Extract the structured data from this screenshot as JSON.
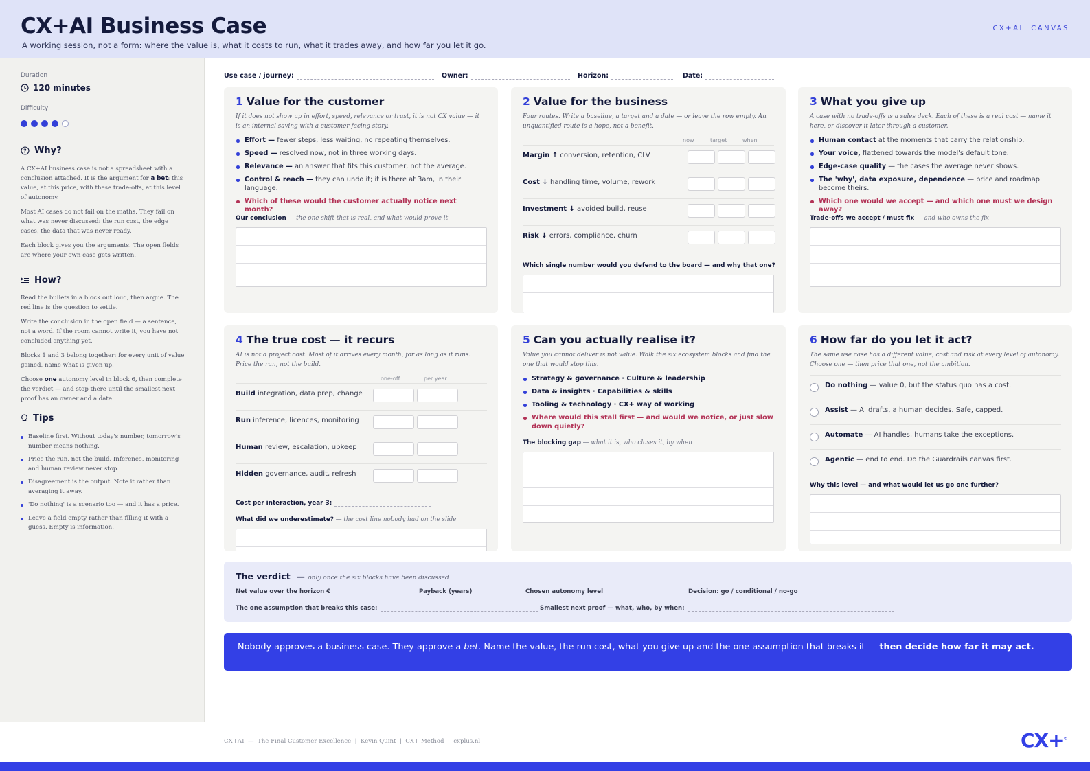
{
  "header": {
    "title": "CX+AI Business Case",
    "subtitle": "A working session, not a form: where the value is, what it costs to run, what it trades away, and how far you let it go.",
    "tag": "CX+AI  CANVAS"
  },
  "sidebar": {
    "duration_label": "Duration",
    "duration_value": "120 minutes",
    "difficulty_label": "Difficulty",
    "difficulty_level": 4,
    "difficulty_max": 5,
    "why_title": "Why?",
    "why_p1_pre": "A CX+AI business case is not a spreadsheet with a conclusion attached. It is the argument for ",
    "why_p1_bold": "a bet",
    "why_p1_post": ": this value, at this price, with these trade-offs, at this level of autonomy.",
    "why_p2": "Most AI cases do not fail on the maths. They fail on what was never discussed: the run cost, the edge cases, the data that was never ready.",
    "why_p3": "Each block gives you the arguments. The open fields are where your own case gets written.",
    "how_title": "How?",
    "how_p1": "Read the bullets in a block out loud, then argue. The red line is the question to settle.",
    "how_p2": "Write the conclusion in the open field — a sentence, not a word. If the room cannot write it, you have not concluded anything yet.",
    "how_p3": "Blocks 1 and 3 belong together: for every unit of value gained, name what is given up.",
    "how_p4_pre": "Choose ",
    "how_p4_bold": "one",
    "how_p4_post": " autonomy level in block 6, then complete the verdict — and stop there until the smallest next proof has an owner and a date.",
    "tips_title": "Tips",
    "tips": [
      "Baseline first. Without today's number, tomorrow's number means nothing.",
      "Price the run, not the build. Inference, monitoring and human review never stop.",
      "Disagreement is the output. Note it rather than averaging it away.",
      "'Do nothing' is a scenario too — and it has a price.",
      "Leave a field empty rather than filling it with a guess. Empty is information."
    ]
  },
  "meta": {
    "usecase": "Use case / journey:",
    "owner": "Owner:",
    "horizon": "Horizon:",
    "date": "Date:"
  },
  "block1": {
    "num": "1",
    "title": "Value for the customer",
    "intro": "If it does not show up in effort, speed, relevance or trust, it is not CX value — it is an internal saving with a customer-facing story.",
    "bullets": [
      {
        "b": "Effort —",
        "t": " fewer steps, less waiting, no repeating themselves."
      },
      {
        "b": "Speed —",
        "t": " resolved now, not in three working days."
      },
      {
        "b": "Relevance —",
        "t": " an answer that fits this customer, not the average."
      },
      {
        "b": "Control & reach —",
        "t": " they can undo it; it is there at 3am, in their language."
      }
    ],
    "question": "Which of these would the customer actually notice next month?",
    "field_label": "Our conclusion",
    "field_hint": " — the one shift that is real, and what would prove it"
  },
  "block2": {
    "num": "2",
    "title": "Value for the business",
    "intro": "Four routes. Write a baseline, a target and a date — or leave the row empty. An unquantified route is a hope, not a benefit.",
    "cols": [
      "now",
      "target",
      "when"
    ],
    "rows": [
      {
        "b": "Margin ↑",
        "t": " conversion, retention, CLV"
      },
      {
        "b": "Cost ↓",
        "t": " handling time, volume, rework"
      },
      {
        "b": "Investment ↓",
        "t": " avoided build, reuse"
      },
      {
        "b": "Risk ↓",
        "t": " errors, compliance, churn"
      }
    ],
    "field_label": "Which single number would you defend to the board — and why that one?"
  },
  "block3": {
    "num": "3",
    "title": "What you give up",
    "intro": "A case with no trade-offs is a sales deck. Each of these is a real cost — name it here, or discover it later through a customer.",
    "bullets": [
      {
        "b": "Human contact",
        "t": " at the moments that carry the relationship."
      },
      {
        "b": "Your voice,",
        "t": " flattened towards the model's default tone."
      },
      {
        "b": "Edge-case quality",
        "t": " — the cases the average never shows."
      },
      {
        "b": "The 'why', data exposure, dependence",
        "t": " — price and roadmap become theirs."
      }
    ],
    "question": "Which one would we accept — and which one must we design away?",
    "field_label": "Trade-offs we accept / must fix",
    "field_hint": " — and who owns the fix"
  },
  "block4": {
    "num": "4",
    "title": "The true cost — it recurs",
    "intro": "AI is not a project cost. Most of it arrives every month, for as long as it runs. Price the run, not the build.",
    "cols": [
      "one-off",
      "per year"
    ],
    "rows": [
      {
        "b": "Build",
        "t": " integration, data prep, change"
      },
      {
        "b": "Run",
        "t": " inference, licences, monitoring"
      },
      {
        "b": "Human",
        "t": " review, escalation, upkeep"
      },
      {
        "b": "Hidden",
        "t": " governance, audit, refresh"
      }
    ],
    "cost_label": "Cost per interaction, year 3:",
    "field_label": "What did we underestimate?",
    "field_hint": " — the cost line nobody had on the slide"
  },
  "block5": {
    "num": "5",
    "title": "Can you actually realise it?",
    "intro": "Value you cannot deliver is not value. Walk the six ecosystem blocks and find the one that would stop this.",
    "bullets": [
      "Strategy & governance · Culture & leadership",
      "Data & insights · Capabilities & skills",
      "Tooling & technology · CX+ way of working"
    ],
    "question": "Where would this stall first — and would we notice, or just slow down quietly?",
    "field_label": "The blocking gap",
    "field_hint": " — what it is, who closes it, by when"
  },
  "block6": {
    "num": "6",
    "title": "How far do you let it act?",
    "intro": "The same use case has a different value, cost and risk at every level of autonomy. Choose one — then price that one, not the ambition.",
    "options": [
      {
        "b": "Do nothing",
        "t": " — value 0, but the status quo has a cost."
      },
      {
        "b": "Assist",
        "t": " — AI drafts, a human decides. Safe, capped."
      },
      {
        "b": "Automate",
        "t": " — AI handles, humans take the exceptions."
      },
      {
        "b": "Agentic",
        "t": " — end to end. Do the Guardrails canvas first."
      }
    ],
    "field_label": "Why this level — and what would let us go one further?"
  },
  "verdict": {
    "title": "The verdict  —",
    "hint": "only once the six blocks have been discussed",
    "net_value": "Net value over the horizon €",
    "payback": "Payback (years)",
    "autonomy": "Chosen autonomy level",
    "decision": "Decision: go / conditional / no-go",
    "assumption": "The one assumption that breaks this case:",
    "proof": "Smallest next proof — what, who, by when:"
  },
  "banner": {
    "pre": "Nobody approves a business case. They approve a ",
    "italic": "bet",
    "mid": ". Name the value, the run cost, what you give up and the one assumption that breaks it — ",
    "bold": "then decide how far it may act."
  },
  "footer": {
    "text": "CX+AI  —  The Final Customer Excellence  |  Kevin Quint  |  CX+ Method  |  cxplus.nl",
    "logo": "CX+",
    "logo_mark": "©"
  },
  "colors": {
    "accent": "#3340e6",
    "header_bg": "#dfe3f8",
    "sidebar_bg": "#f1f1ee",
    "card_bg": "#f4f4f2",
    "question_red": "#b23256",
    "verdict_bg": "#e9ebf9"
  }
}
